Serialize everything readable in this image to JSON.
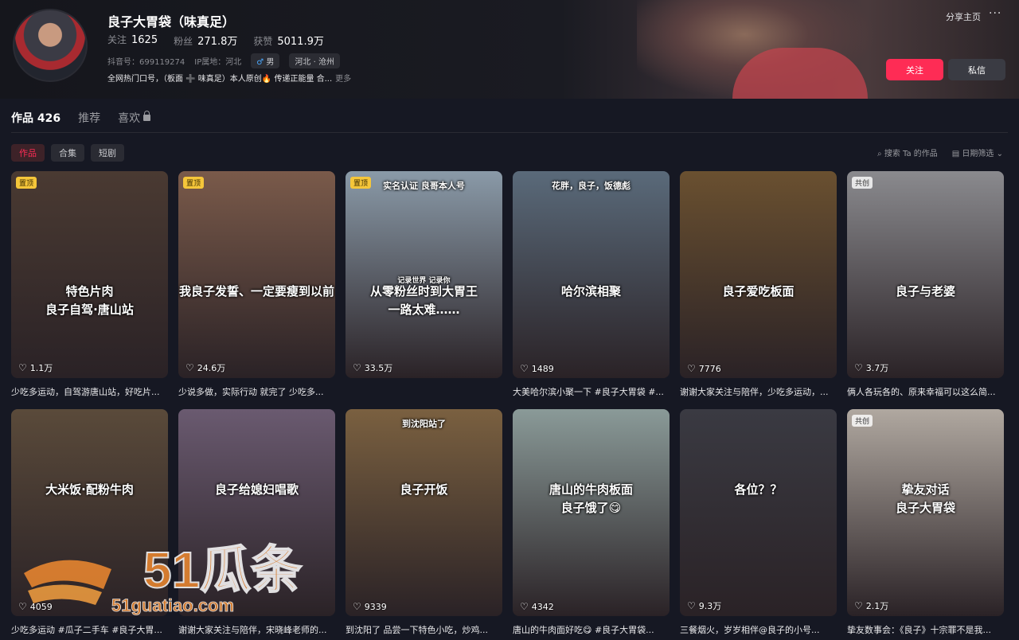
{
  "profile": {
    "name": "良子大胃袋（味真足）",
    "stats": [
      {
        "label": "关注",
        "value": "1625"
      },
      {
        "label": "粉丝",
        "value": "271.8万"
      },
      {
        "label": "获赞",
        "value": "5011.9万"
      }
    ],
    "douyin_id": "抖音号：699119274",
    "ip": "IP属地：河北",
    "gender": "男",
    "location": "河北 · 沧州",
    "bio": "全网热门口号，（板面 ➕ 味真足）本人原创🔥 传递正能量 合...",
    "more": "更多",
    "share_label": "分享主页",
    "more_icon": "···",
    "follow_label": "关注",
    "message_label": "私信"
  },
  "tabs": [
    {
      "label": "作品 426",
      "active": true
    },
    {
      "label": "推荐",
      "active": false
    },
    {
      "label": "喜欢",
      "active": false
    }
  ],
  "subtabs": [
    {
      "label": "作品",
      "active": true
    },
    {
      "label": "合集",
      "active": false
    },
    {
      "label": "短剧",
      "active": false
    }
  ],
  "tools": {
    "search": "搜索 Ta 的作品",
    "filter": "日期筛选"
  },
  "watermark": {
    "big": "51瓜条",
    "small": "51guatiao.com"
  },
  "videos": [
    {
      "badge": "置顶",
      "caption": "特色片肉\n良子自驾·唐山站",
      "likes": "1.1万",
      "title": "少吃多运动，自驾游唐山站，好吃片...",
      "bg": "#4a3a32"
    },
    {
      "badge": "置顶",
      "caption": "我良子发誓、一定要瘦到以前",
      "likes": "24.6万",
      "title": "少说多做，实际行动 就完了 少吃多...",
      "bg": "#7a5a4a"
    },
    {
      "badge": "置顶",
      "caption": "从零粉丝时到大胃王\n一路太难……",
      "likes": "33.5万",
      "title": "",
      "bg": "#8a9aa8",
      "top_text": "实名认证 良哥本人号",
      "sub_text": "记录世界 记录你"
    },
    {
      "badge": "",
      "caption": "哈尔滨相聚",
      "likes": "1489",
      "title": "大美哈尔滨小聚一下 #良子大胃袋 #...",
      "bg": "#5a6a7a",
      "top_text": "花胖，良子，饭德彪"
    },
    {
      "badge": "",
      "caption": "良子爱吃板面",
      "likes": "7776",
      "title": "谢谢大家关注与陪伴，少吃多运动，...",
      "bg": "#6a5030"
    },
    {
      "badge": "共创",
      "caption": "良子与老婆",
      "likes": "3.7万",
      "title": "俩人各玩各的、原来幸福可以这么简...",
      "bg": "#8a8a8e"
    },
    {
      "badge": "",
      "caption": "大米饭·配粉牛肉",
      "likes": "4059",
      "title": "少吃多运动 #瓜子二手车 #良子大胃...",
      "bg": "#5a4a3a"
    },
    {
      "badge": "",
      "caption": "良子给媳妇唱歌",
      "likes": "",
      "title": "谢谢大家关注与陪伴，宋晓峰老师的...",
      "bg": "#6a5a70"
    },
    {
      "badge": "",
      "caption": "良子开饭",
      "likes": "9339",
      "title": "到沈阳了 品尝一下特色小吃，炒鸡...",
      "bg": "#7a6040",
      "top_text": "到沈阳站了"
    },
    {
      "badge": "",
      "caption": "唐山的牛肉板面\n良子饿了😋",
      "likes": "4342",
      "title": "唐山的牛肉面好吃😋 #良子大胃袋...",
      "bg": "#8a9a98"
    },
    {
      "badge": "",
      "caption": "各位？？",
      "likes": "9.3万",
      "title": "三餐烟火，岁岁相伴@良子的小号...",
      "bg": "#3a3a42"
    },
    {
      "badge": "共创",
      "caption": "挚友对话\n良子大胃袋",
      "likes": "2.1万",
      "title": "挚友数事会：《良子》十宗罪不是我...",
      "bg": "#b0a8a0"
    }
  ]
}
